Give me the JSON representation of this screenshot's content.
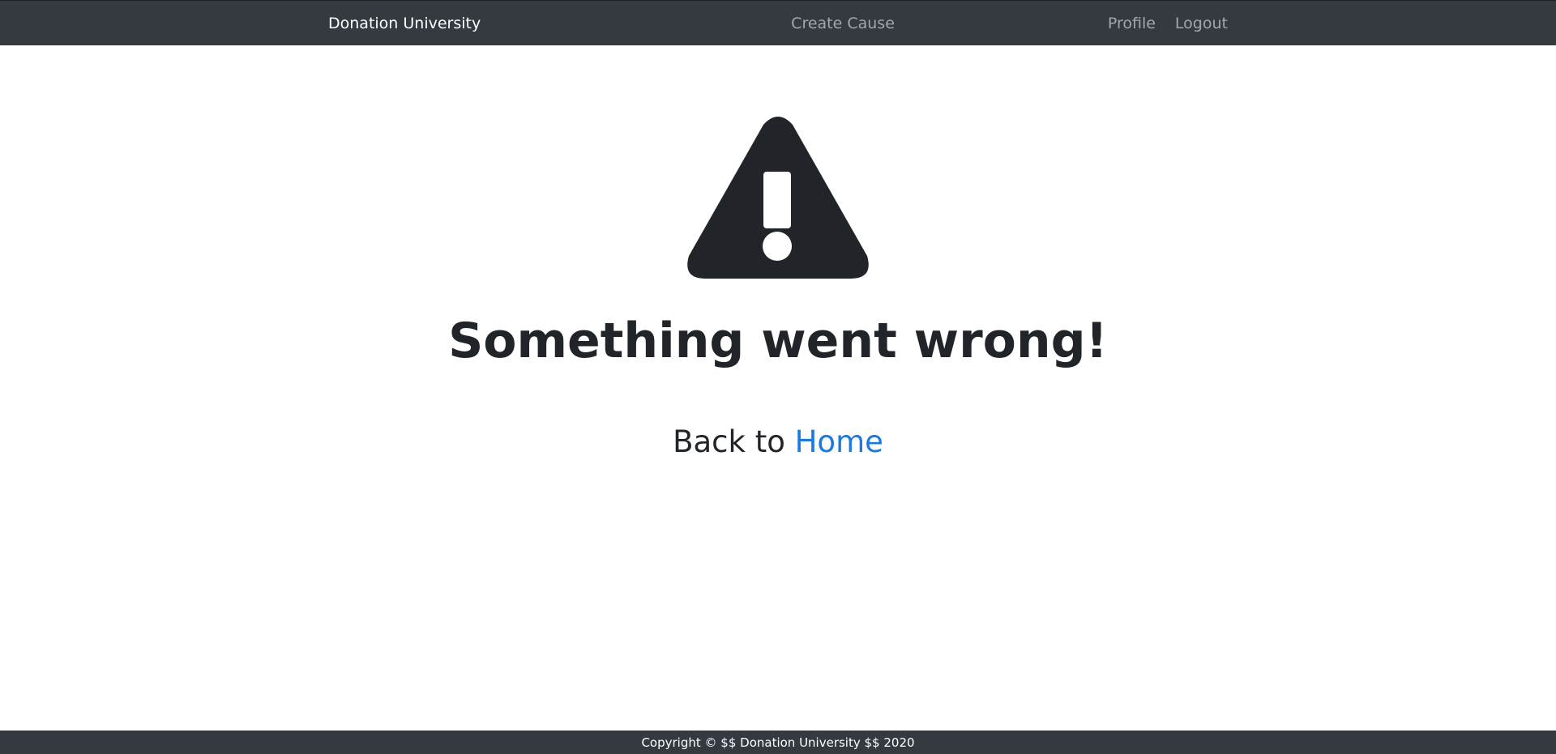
{
  "navbar": {
    "brand": "Donation University",
    "create_cause": "Create Cause",
    "profile": "Profile",
    "logout": "Logout"
  },
  "error": {
    "icon": "exclamation-triangle-icon",
    "title": "Something went wrong!",
    "back_prefix": "Back to ",
    "back_link": "Home"
  },
  "footer": {
    "copyright": "Copyright © $$ Donation University $$ 2020"
  },
  "colors": {
    "navbar_bg": "#343a40",
    "link": "#1a7ae0",
    "text": "#212529"
  }
}
